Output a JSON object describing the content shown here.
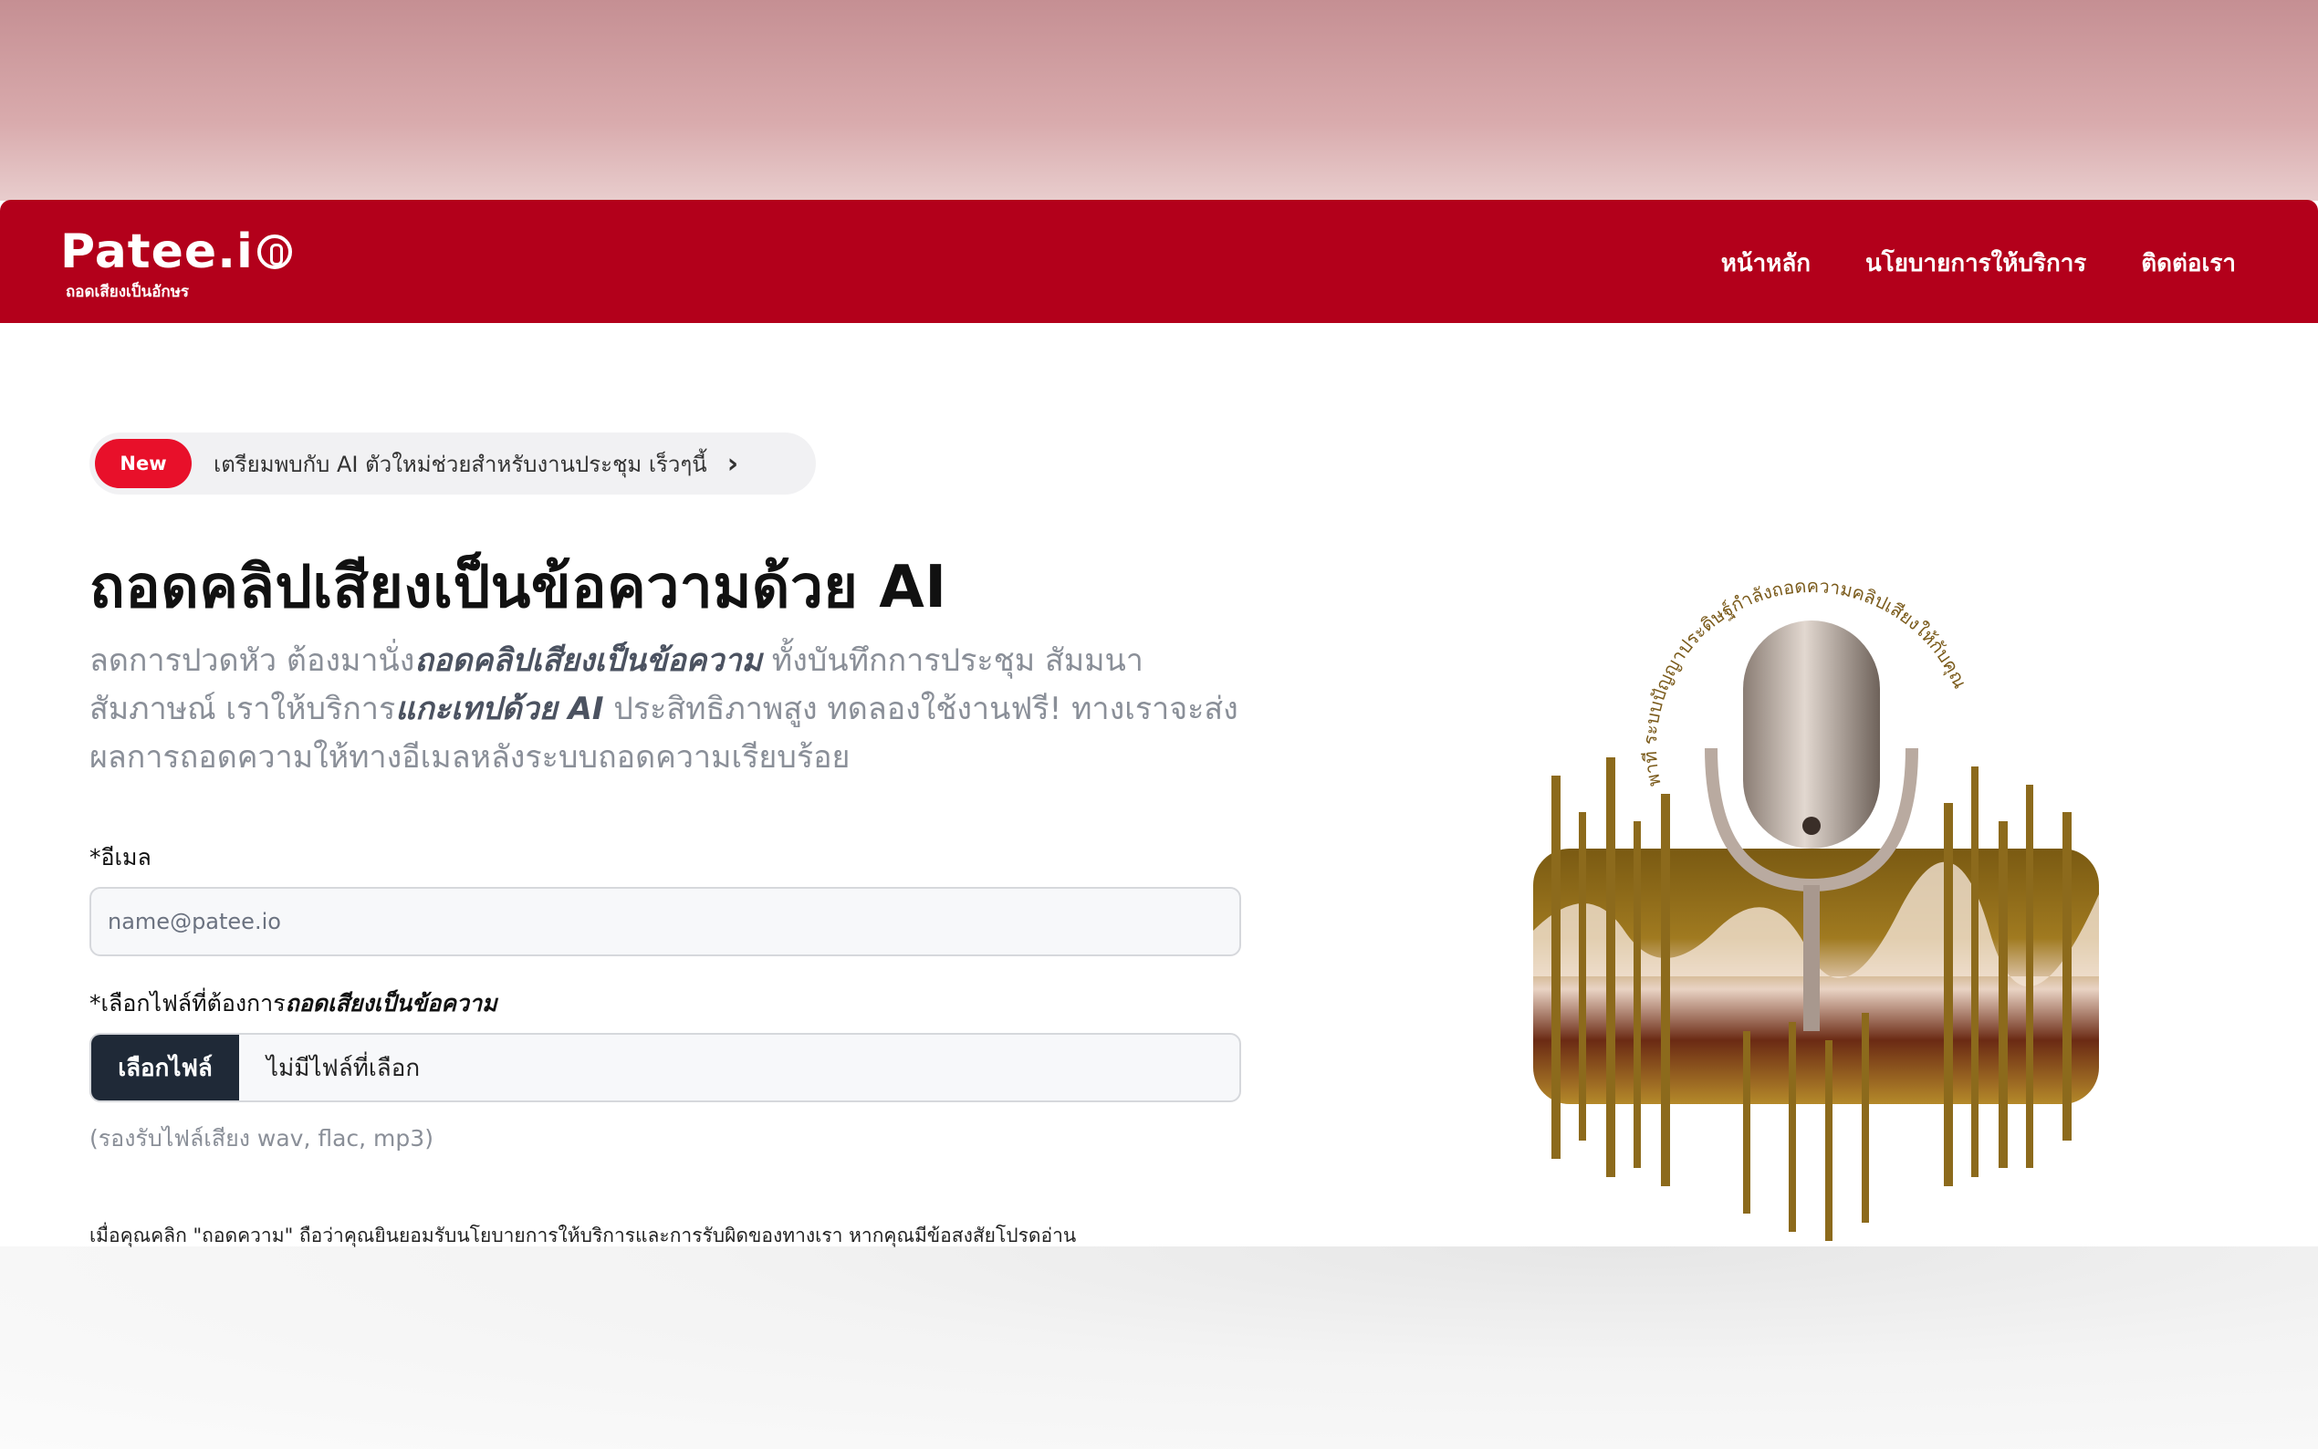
{
  "brand": {
    "logo_text": "Patee.i",
    "tagline": "ถอดเสียงเป็นอักษร",
    "color": "#b3001b"
  },
  "nav": {
    "items": [
      {
        "label": "หน้าหลัก"
      },
      {
        "label": "นโยบายการให้บริการ"
      },
      {
        "label": "ติดต่อเรา"
      }
    ]
  },
  "announcement": {
    "badge": "New",
    "text": "เตรียมพบกับ AI ตัวใหม่ช่วยสำหรับงานประชุม เร็วๆนี้",
    "icon": "chevron-right-icon"
  },
  "hero": {
    "title": "ถอดคลิปเสียงเป็นข้อความด้วย AI",
    "desc_1": "ลดการปวดหัว ต้องมานั่ง",
    "desc_bold_1": "ถอดคลิปเสียงเป็นข้อความ",
    "desc_2": " ทั้งบันทึกการประชุม สัมมนา สัมภาษณ์ เราให้บริการ",
    "desc_bold_2": "แกะเทปด้วย AI",
    "desc_3": " ประสิทธิภาพสูง ทดลองใช้งานฟรี! ทางเราจะส่งผลการถอดความให้ทางอีเมลหลังระบบถอดความเรียบร้อย"
  },
  "form": {
    "email_label": "*อีเมล",
    "email_placeholder": "name@patee.io",
    "email_value": "",
    "file_label_prefix": "*เลือกไฟล์ที่ต้องการ",
    "file_label_emphasis": "ถอดเสียงเป็นข้อความ",
    "file_button": "เลือกไฟล์",
    "file_status": "ไม่มีไฟล์ที่เลือก",
    "file_hint": "(รองรับไฟล์เสียง wav, flac, mp3)",
    "terms": "เมื่อคุณคลิก \"ถอดความ\" ถือว่าคุณยินยอมรับนโยบายการให้บริการและการรับผิดของทางเรา หากคุณมีข้อสงสัยโปรดอ่าน"
  },
  "illustration": {
    "name": "microphone-waveform-illustration",
    "circle_text": "พาที ระบบปัญญาประดิษฐ์กำลังถอดความคลิปเสียงให้กับคุณ"
  }
}
